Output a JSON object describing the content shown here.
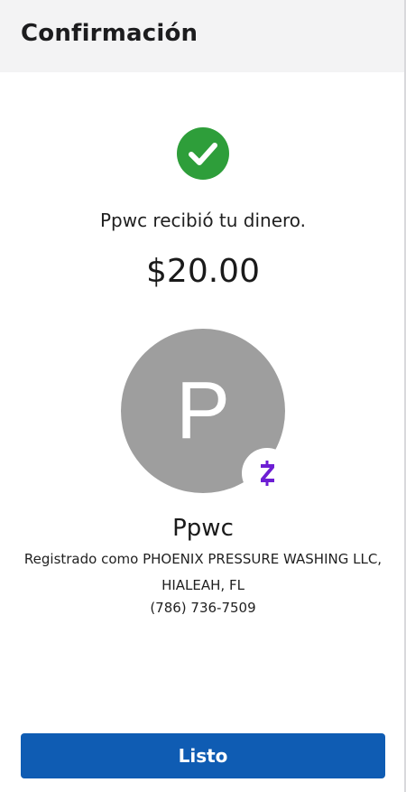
{
  "header": {
    "title": "Confirmación"
  },
  "confirmation": {
    "status_icon": "check-circle-icon",
    "message": "Ppwc recibió tu dinero.",
    "amount": "$20.00"
  },
  "recipient": {
    "avatar_letter": "P",
    "badge_icon": "zelle-icon",
    "name": "Ppwc",
    "registered_as": "Registrado como PHOENIX PRESSURE WASHING LLC,",
    "location": "HIALEAH, FL",
    "phone": "(786) 736-7509"
  },
  "footer": {
    "done_label": "Listo"
  },
  "colors": {
    "success": "#2e9e3a",
    "primary": "#0f5cb3",
    "zelle": "#6d1ed4",
    "avatar_bg": "#9e9e9e"
  }
}
